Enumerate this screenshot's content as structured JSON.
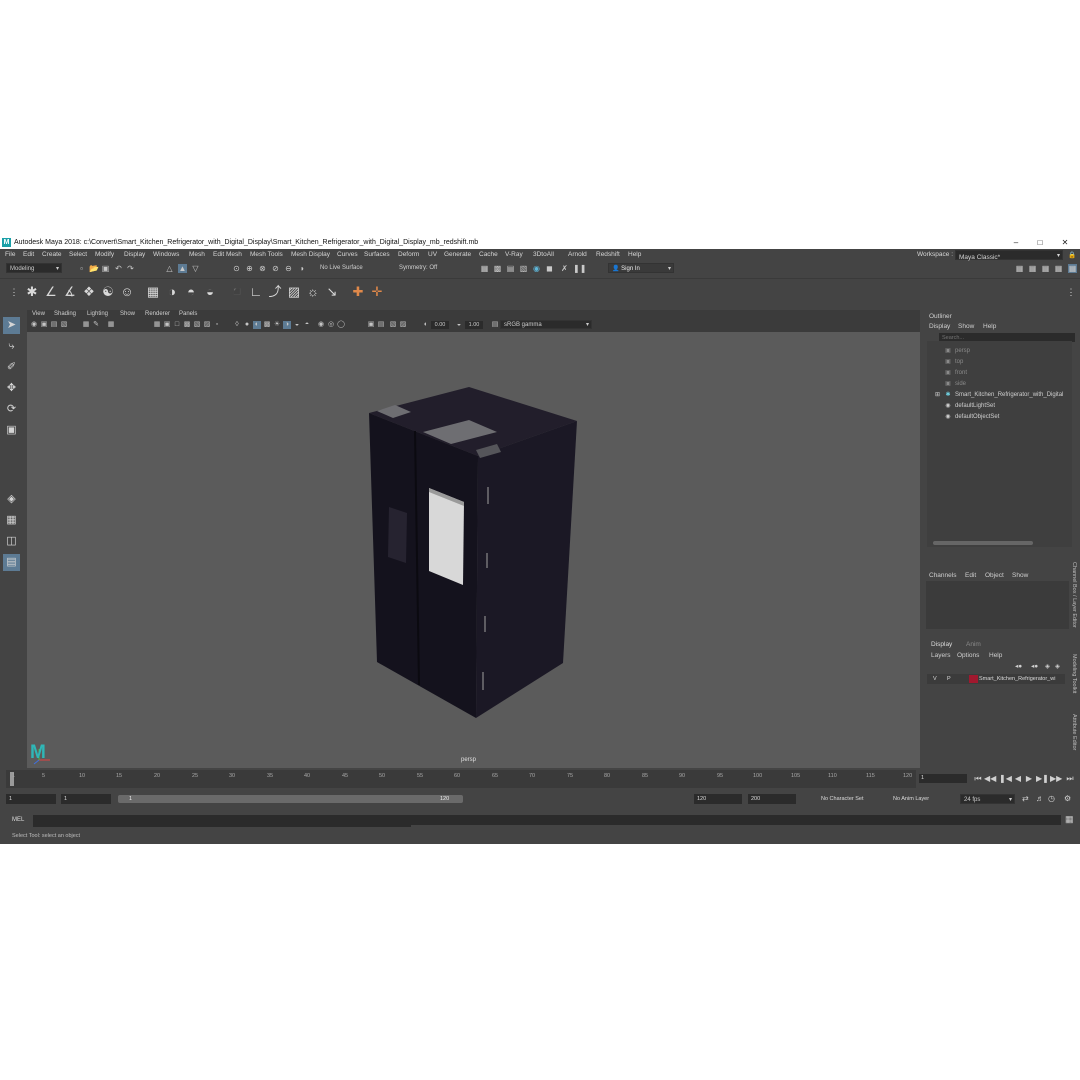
{
  "window": {
    "title": "Autodesk Maya 2018: c:\\Convert\\Smart_Kitchen_Refrigerator_with_Digital_Display\\Smart_Kitchen_Refrigerator_with_Digital_Display_mb_redshift.mb",
    "logo": "M"
  },
  "menubar": [
    "File",
    "Edit",
    "Create",
    "Select",
    "Modify",
    "Display",
    "Windows",
    "Mesh",
    "Edit Mesh",
    "Mesh Tools",
    "Mesh Display",
    "Curves",
    "Surfaces",
    "Deform",
    "UV",
    "Generate",
    "Cache",
    "V-Ray",
    "3DtoAll",
    "Arnold",
    "Redshift",
    "Help"
  ],
  "workspace": {
    "label": "Workspace :",
    "value": "Maya Classic*"
  },
  "toolbar": {
    "mode": "Modeling",
    "live_surface": "No Live Surface",
    "symmetry": "Symmetry: Off",
    "sign_in": "Sign In"
  },
  "viewport": {
    "menu": [
      "View",
      "Shading",
      "Lighting",
      "Show",
      "Renderer",
      "Panels"
    ],
    "exposure": "0.00",
    "gamma": "1.00",
    "color_space": "sRGB gamma",
    "camera": "persp",
    "logo": "M"
  },
  "outliner": {
    "title": "Outliner",
    "menu": [
      "Display",
      "Show",
      "Help"
    ],
    "search_placeholder": "Search...",
    "items": [
      {
        "label": "persp",
        "icon": "camera-icon"
      },
      {
        "label": "top",
        "icon": "camera-icon"
      },
      {
        "label": "front",
        "icon": "camera-icon"
      },
      {
        "label": "side",
        "icon": "camera-icon"
      },
      {
        "label": "Smart_Kitchen_Refrigerator_with_Digital",
        "icon": "group-icon"
      },
      {
        "label": "defaultLightSet",
        "icon": "set-icon"
      },
      {
        "label": "defaultObjectSet",
        "icon": "set-icon"
      }
    ]
  },
  "channel_box": {
    "menu": [
      "Channels",
      "Edit",
      "Object",
      "Show"
    ]
  },
  "layer_editor": {
    "tabs": [
      "Display",
      "Anim"
    ],
    "menu": [
      "Layers",
      "Options",
      "Help"
    ],
    "layer": {
      "v": "V",
      "p": "P",
      "name": "Smart_Kitchen_Refrigerator_wi",
      "color": "#a0182e"
    }
  },
  "side_tabs": [
    "Channel Box / Layer Editor",
    "Modeling Toolkit",
    "Attribute Editor"
  ],
  "timeline": {
    "ticks": [
      "5",
      "10",
      "15",
      "20",
      "25",
      "30",
      "35",
      "40",
      "45",
      "50",
      "55",
      "60",
      "65",
      "70",
      "75",
      "80",
      "85",
      "90",
      "95",
      "100",
      "105",
      "110",
      "115",
      "120"
    ],
    "first": "1",
    "current_frame": "1"
  },
  "range": {
    "start": "1",
    "playback_start": "1",
    "slider_start": "1",
    "slider_end": "120",
    "playback_end": "120",
    "end": "200",
    "character_set": "No Character Set",
    "anim_layer": "No Anim Layer",
    "fps": "24 fps"
  },
  "command": {
    "label": "MEL"
  },
  "status": {
    "help": "Select Tool: select an object"
  }
}
